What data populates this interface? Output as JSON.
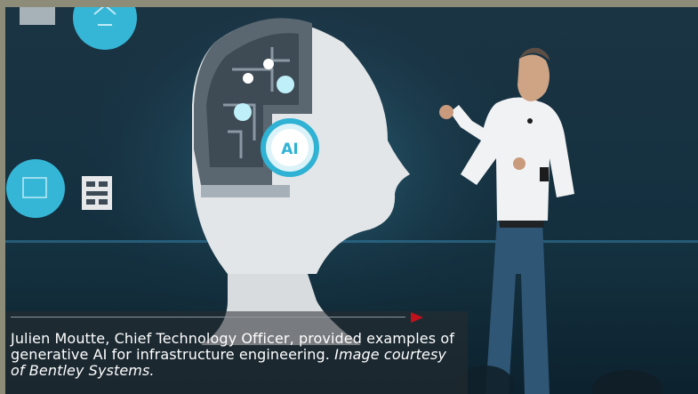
{
  "caption": {
    "main_text": "Julien Moutte, Chief Technology Officer, provided examples of generative AI for infrastructure engineering.",
    "credit_text": "Image courtesy of Bentley Systems."
  },
  "photo": {
    "screen_label": "AI"
  },
  "colors": {
    "border": "#8c8c78",
    "screen_background": "#1b3444",
    "accent_arrow": "#c0111d",
    "caption_text": "#ffffff"
  }
}
